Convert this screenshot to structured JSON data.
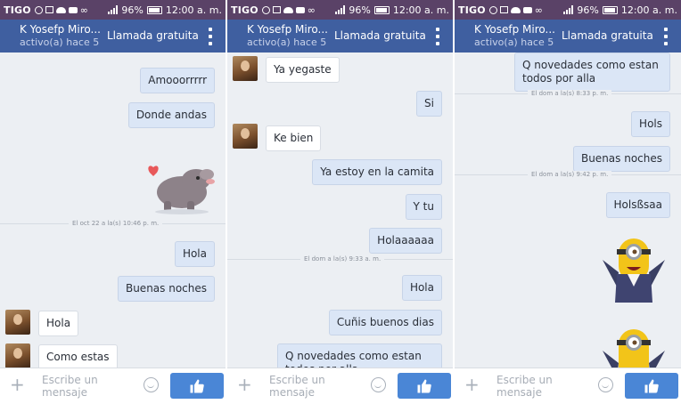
{
  "status": {
    "carrier": "TIGO",
    "battery": "96%",
    "time": "12:00 a. m."
  },
  "header": {
    "contact": "K Yosefp Miro...",
    "active": "activo(a) hace 5",
    "call": "Llamada gratuita"
  },
  "composer": {
    "placeholder": "Escribe un mensaje"
  },
  "panel1": {
    "m1": "Amooorrrrr",
    "m2": "Donde andas",
    "divider": "El oct 22 a la(s) 10:46 p. m.",
    "m3": "Hola",
    "m4": "Buenas noches",
    "m5": "Hola",
    "m6": "Como estas"
  },
  "panel2": {
    "m1": "Ya yegaste",
    "m2": "Si",
    "m3": "Ke bien",
    "m4": "Ya estoy en la camita",
    "m5": "Y tu",
    "m6": "Holaaaaaa",
    "divider": "El dom a la(s) 9:33 a. m.",
    "m7": "Hola",
    "m8": "Cuñis buenos dias",
    "m9": "Q novedades como estan todos por alla"
  },
  "panel3": {
    "m1": "Q novedades como estan todos por alla",
    "divider1": "El dom a la(s) 8:33 p. m.",
    "m2": "Hols",
    "m3": "Buenas noches",
    "divider2": "El dom a la(s) 9:42 p. m.",
    "m4": "Holsßsaa"
  },
  "colors": {
    "statusbar": "#5a4267",
    "header": "#3f5fa0",
    "outgoing": "#dbe6f6",
    "like": "#4a86d6"
  },
  "icons": [
    "plus-icon",
    "smile-icon",
    "thumbs-up-icon",
    "menu-icon",
    "battery-icon",
    "signal-icon"
  ]
}
